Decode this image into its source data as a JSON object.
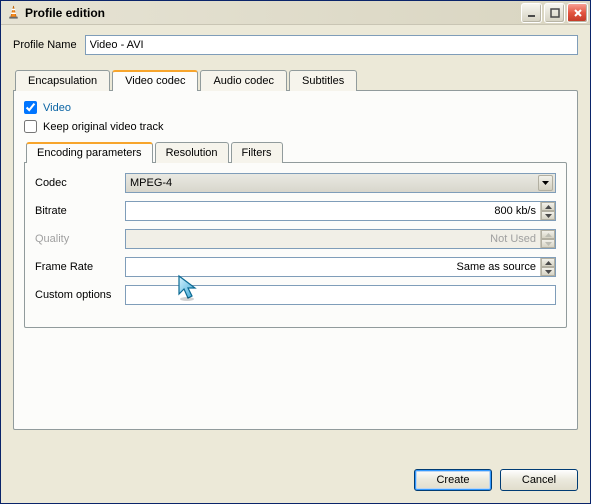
{
  "window": {
    "title": "Profile edition"
  },
  "profile_name_label": "Profile Name",
  "profile_name_value": "Video - AVI",
  "main_tabs": {
    "encapsulation": "Encapsulation",
    "video_codec": "Video codec",
    "audio_codec": "Audio codec",
    "subtitles": "Subtitles"
  },
  "video_check": "Video",
  "keep_original_check": "Keep original video track",
  "sub_tabs": {
    "encoding_parameters": "Encoding parameters",
    "resolution": "Resolution",
    "filters": "Filters"
  },
  "form": {
    "codec_label": "Codec",
    "codec_value": "MPEG-4",
    "bitrate_label": "Bitrate",
    "bitrate_value": "800 kb/s",
    "quality_label": "Quality",
    "quality_value": "Not Used",
    "framerate_label": "Frame Rate",
    "framerate_value": "Same as source",
    "custom_label": "Custom options",
    "custom_value": ""
  },
  "footer": {
    "create": "Create",
    "cancel": "Cancel"
  }
}
